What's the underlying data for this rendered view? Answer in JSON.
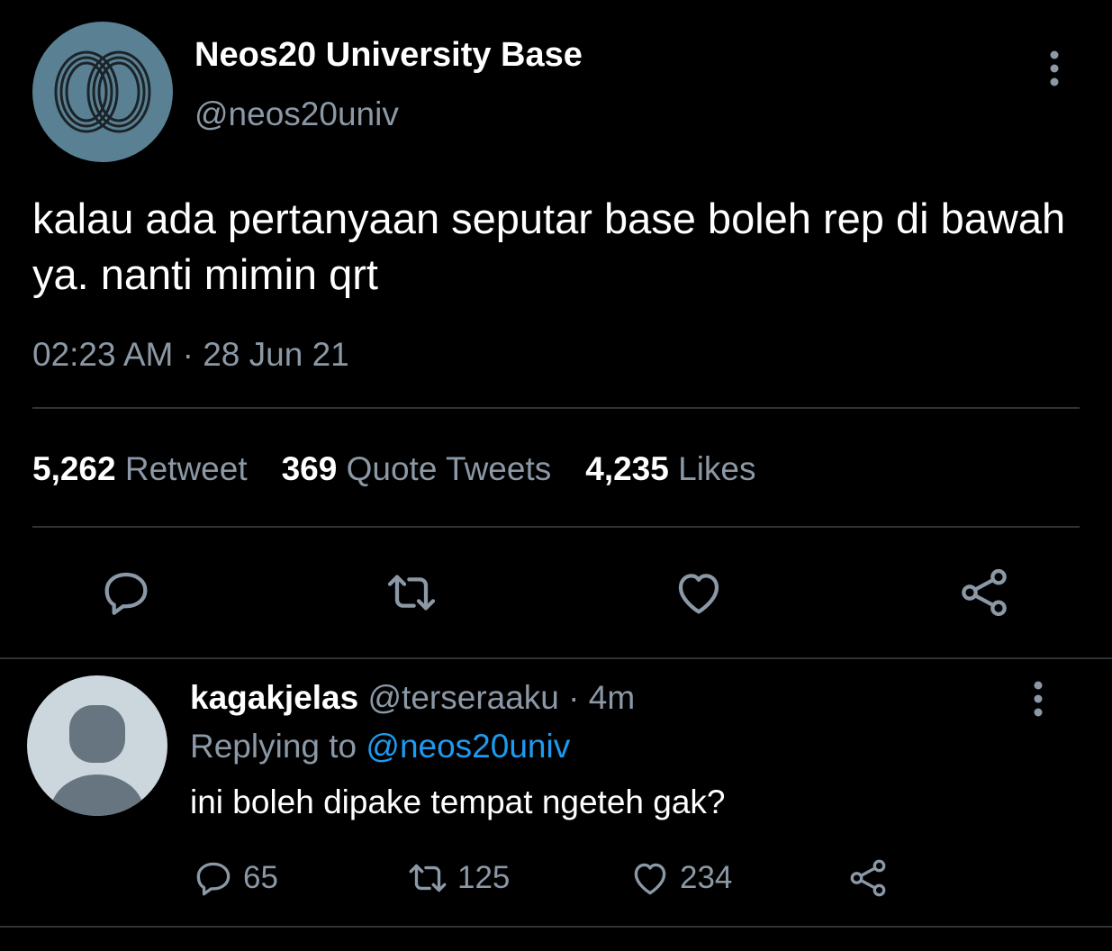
{
  "main_tweet": {
    "display_name": "Neos20 University Base",
    "handle": "@neos20univ",
    "text": "kalau ada pertanyaan seputar base boleh rep di bawah ya. nanti mimin qrt",
    "timestamp": "02:23 AM · 28 Jun 21",
    "stats": {
      "retweets_count": "5,262",
      "retweets_label": "Retweet",
      "quotes_count": "369",
      "quotes_label": "Quote Tweets",
      "likes_count": "4,235",
      "likes_label": "Likes"
    },
    "actions": [
      "reply-icon",
      "retweet-icon",
      "heart-icon",
      "share-icon"
    ],
    "more_icon": "more-vertical-icon"
  },
  "reply": {
    "display_name": "kagakjelas",
    "handle": "@terseraaku",
    "time_ago": "· 4m",
    "replying_prefix": "Replying to",
    "replying_to": "@neos20univ",
    "text": "ini boleh dipake tempat ngeteh gak?",
    "reply_count": "65",
    "retweet_count": "125",
    "like_count": "234",
    "more_icon": "more-vertical-icon"
  },
  "colors": {
    "background": "#000000",
    "text_primary": "#ffffff",
    "text_secondary": "#8b98a5",
    "link": "#1d9bf0",
    "divider": "#2f3336",
    "main_avatar_bg": "#5a8193",
    "default_avatar_bg": "#ccd6dd",
    "default_avatar_figure": "#66757f"
  }
}
